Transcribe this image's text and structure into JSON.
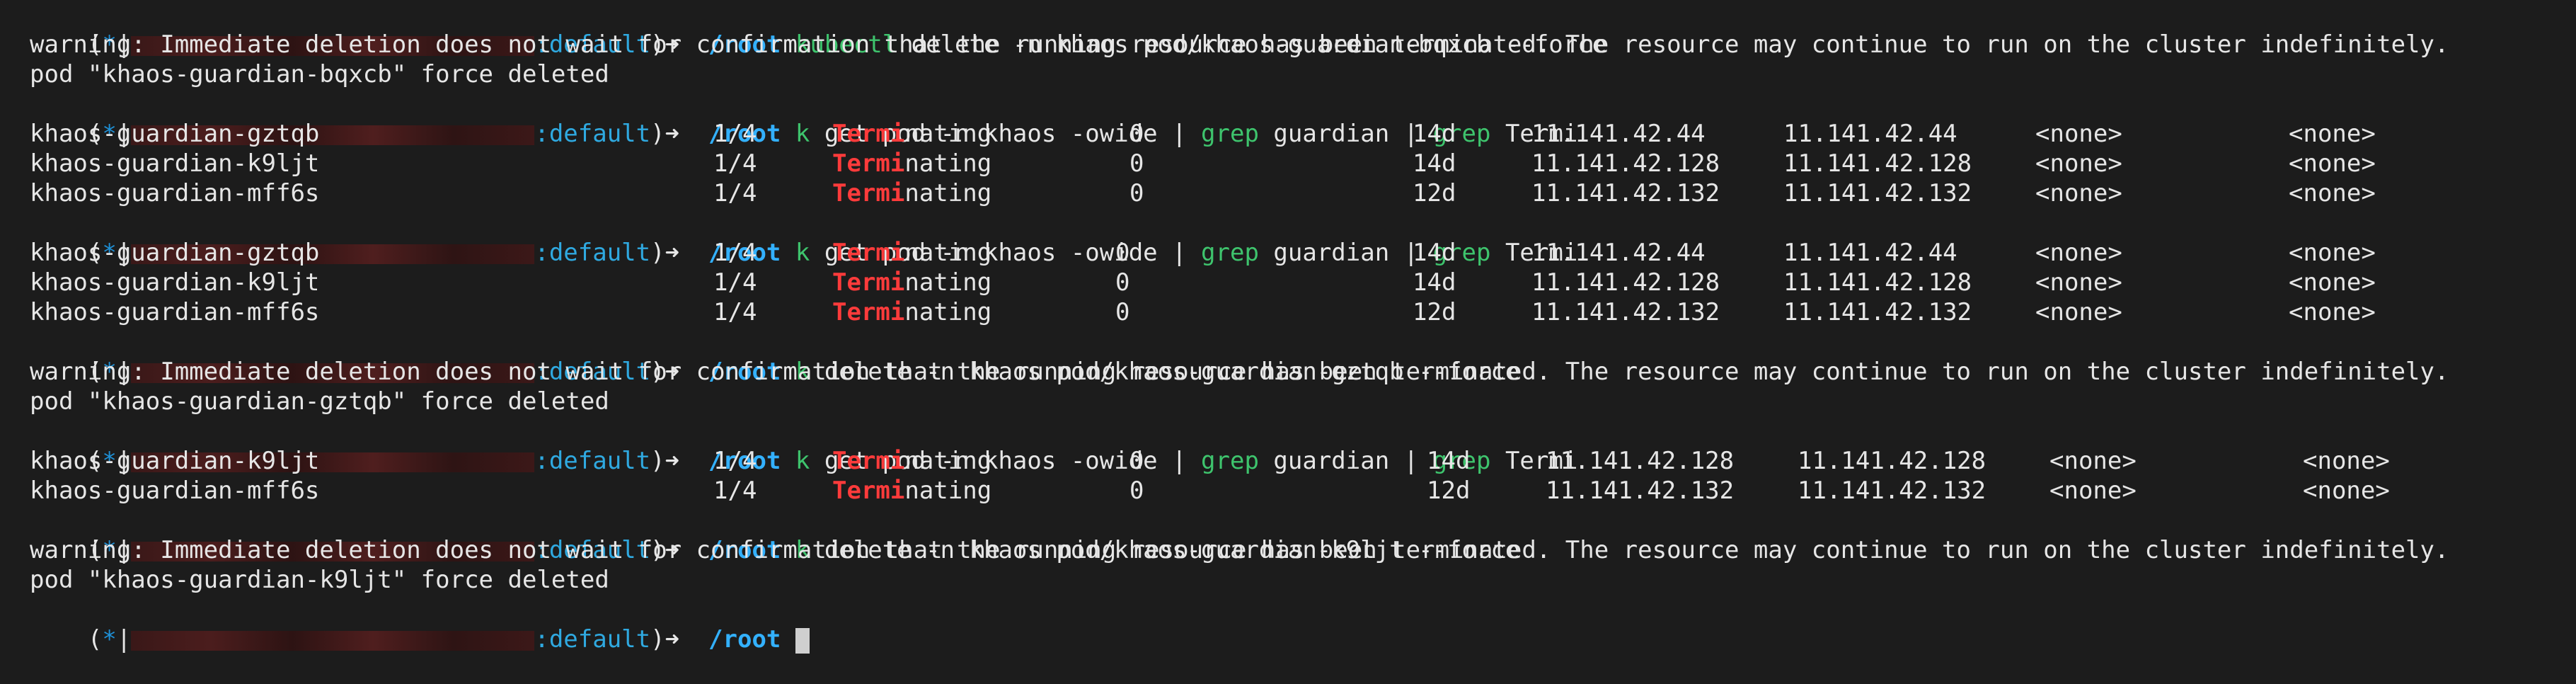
{
  "prompt": {
    "open": "(",
    "star": "*",
    "bar": "|",
    "context": ":default",
    "close": ")",
    "arrow": "➜",
    "path": "/root"
  },
  "commands": {
    "c1_a": "kubectl",
    "c1_b": " delete -n khaos pod/khaos-guardian-bqxcb --force",
    "k": "k",
    "get_a": " get pod -n khaos -owide | ",
    "grep": "grep",
    "get_b": " guardian | ",
    "get_c": " Termi",
    "del2": " delete -n khaos pod/khaos-guardian-gztqb --force",
    "del3": " delete -n khaos pod/khaos-guardian-k9ljt --force"
  },
  "messages": {
    "warning": "warning: Immediate deletion does not wait for confirmation that the running resource has been terminated. The resource may continue to run on the cluster indefinitely.",
    "deleted_1": "pod \"khaos-guardian-bqxcb\" force deleted",
    "deleted_2": "pod \"khaos-guardian-gztqb\" force deleted",
    "deleted_3": "pod \"khaos-guardian-k9ljt\" force deleted"
  },
  "status": {
    "hl": "Termi",
    "rest": "nating"
  },
  "tables": {
    "t1": [
      {
        "name": "khaos-guardian-gztqb",
        "ready": "1/4",
        "restarts": "0",
        "age": "14d",
        "ip": "11.141.42.44",
        "node": "11.141.42.44",
        "nominated": "<none>",
        "gates": "<none>"
      },
      {
        "name": "khaos-guardian-k9ljt",
        "ready": "1/4",
        "restarts": "0",
        "age": "14d",
        "ip": "11.141.42.128",
        "node": "11.141.42.128",
        "nominated": "<none>",
        "gates": "<none>"
      },
      {
        "name": "khaos-guardian-mff6s",
        "ready": "1/4",
        "restarts": "0",
        "age": "12d",
        "ip": "11.141.42.132",
        "node": "11.141.42.132",
        "nominated": "<none>",
        "gates": "<none>"
      }
    ],
    "t2": [
      {
        "name": "khaos-guardian-gztqb",
        "ready": "1/4",
        "restarts": "0",
        "age": "14d",
        "ip": "11.141.42.44",
        "node": "11.141.42.44",
        "nominated": "<none>",
        "gates": "<none>"
      },
      {
        "name": "khaos-guardian-k9ljt",
        "ready": "1/4",
        "restarts": "0",
        "age": "14d",
        "ip": "11.141.42.128",
        "node": "11.141.42.128",
        "nominated": "<none>",
        "gates": "<none>"
      },
      {
        "name": "khaos-guardian-mff6s",
        "ready": "1/4",
        "restarts": "0",
        "age": "12d",
        "ip": "11.141.42.132",
        "node": "11.141.42.132",
        "nominated": "<none>",
        "gates": "<none>"
      }
    ],
    "t3": [
      {
        "name": "khaos-guardian-k9ljt",
        "ready": "1/4",
        "restarts": "0",
        "age": "14d",
        "ip": "11.141.42.128",
        "node": "11.141.42.128",
        "nominated": "<none>",
        "gates": "<none>"
      },
      {
        "name": "khaos-guardian-mff6s",
        "ready": "1/4",
        "restarts": "0",
        "age": "12d",
        "ip": "11.141.42.132",
        "node": "11.141.42.132",
        "nominated": "<none>",
        "gates": "<none>"
      }
    ]
  }
}
